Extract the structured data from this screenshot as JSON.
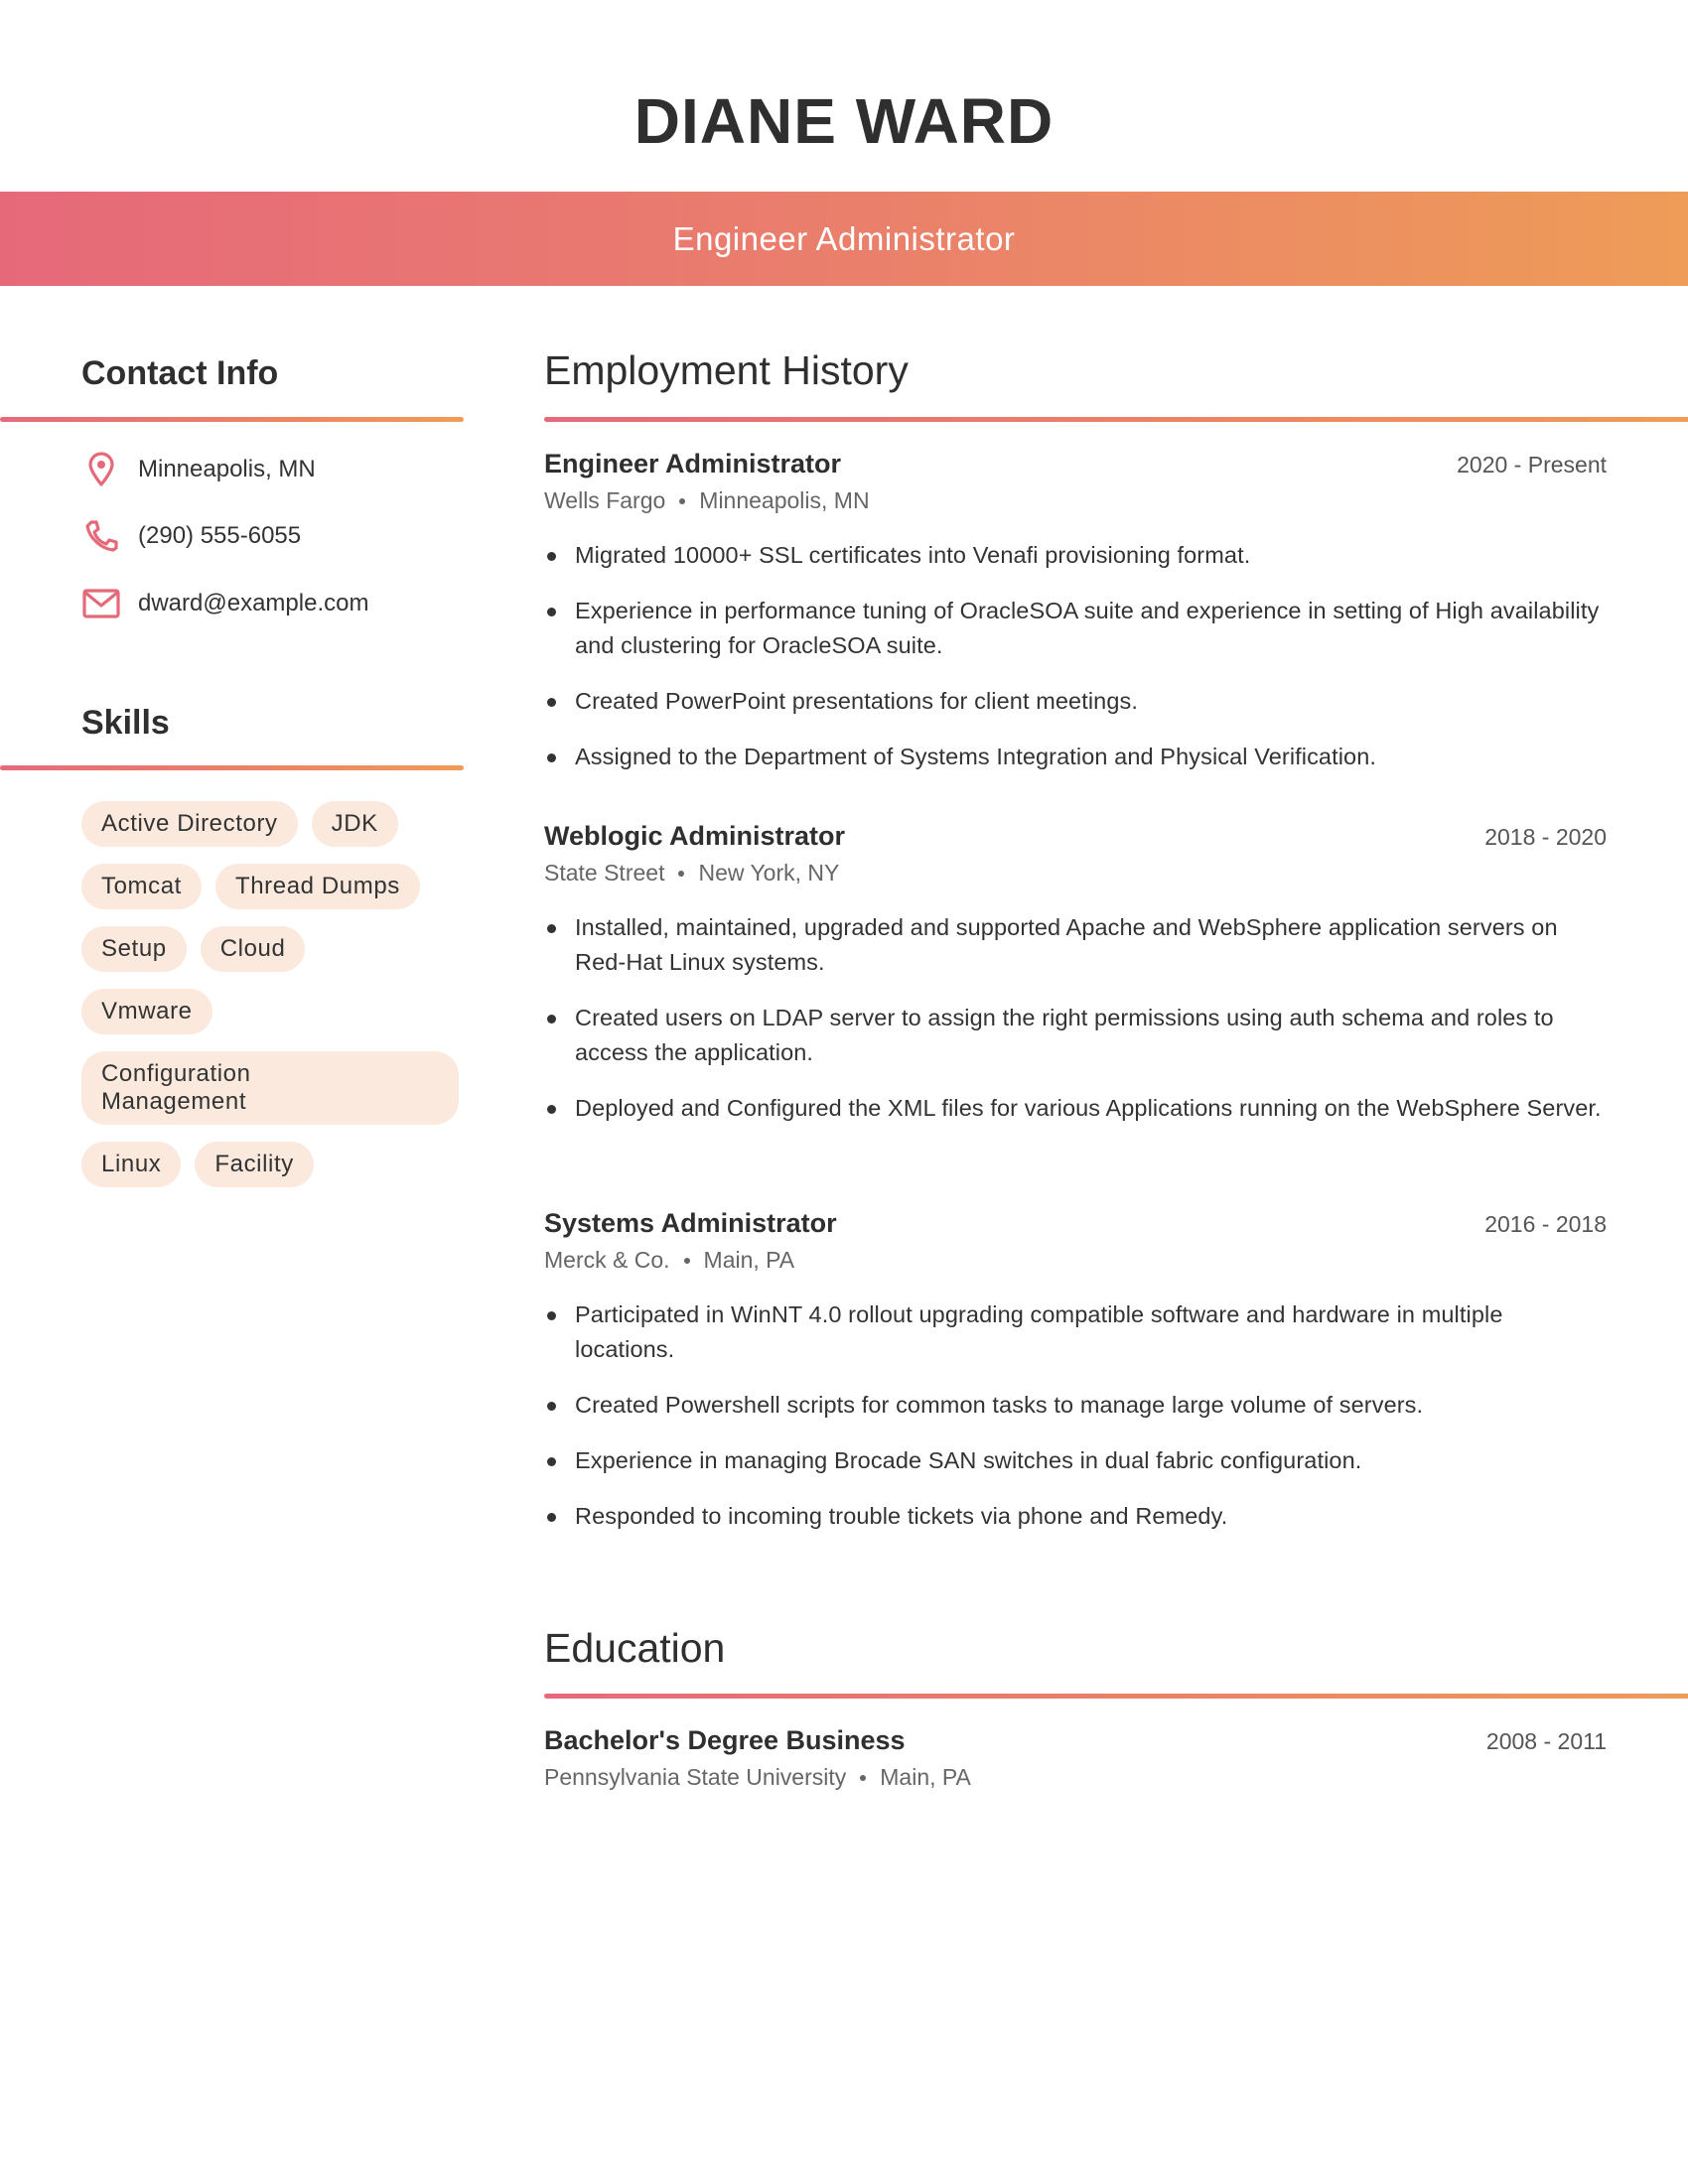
{
  "header": {
    "name": "DIANE WARD",
    "title": "Engineer Administrator"
  },
  "colors": {
    "gradient_start": "#e6697a",
    "gradient_end": "#ee9c58",
    "pill_bg": "#fbe9dd",
    "icon": "#e46a7a",
    "text": "#333333"
  },
  "contact": {
    "heading": "Contact Info",
    "items": [
      {
        "icon": "location-pin-icon",
        "text": "Minneapolis, MN"
      },
      {
        "icon": "phone-icon",
        "text": "(290) 555-6055"
      },
      {
        "icon": "mail-icon",
        "text": "dward@example.com"
      }
    ]
  },
  "skills": {
    "heading": "Skills",
    "items": [
      "Active Directory",
      "JDK",
      "Tomcat",
      "Thread Dumps",
      "Setup",
      "Cloud",
      "Vmware",
      "Configuration Management",
      "Linux",
      "Facility"
    ]
  },
  "employment": {
    "heading": "Employment History",
    "jobs": [
      {
        "title": "Engineer Administrator",
        "dates": "2020 - Present",
        "company": "Wells Fargo",
        "location": "Minneapolis, MN",
        "bullets": [
          "Migrated 10000+ SSL certificates into Venafi provisioning format.",
          "Experience in performance tuning of OracleSOA suite and experience in setting of High availability and clustering for OracleSOA suite.",
          "Created PowerPoint presentations for client meetings.",
          "Assigned to the Department of Systems Integration and Physical Verification."
        ]
      },
      {
        "title": "Weblogic Administrator",
        "dates": "2018 - 2020",
        "company": "State Street",
        "location": "New York, NY",
        "bullets": [
          "Installed, maintained, upgraded and supported Apache and WebSphere application servers on Red-Hat Linux systems.",
          "Created users on LDAP server to assign the right permissions using auth schema and roles to access the application.",
          "Deployed and Configured the XML files for various Applications running on the WebSphere Server."
        ]
      },
      {
        "title": "Systems Administrator",
        "dates": "2016 - 2018",
        "company": "Merck & Co.",
        "location": "Main, PA",
        "bullets": [
          "Participated in WinNT 4.0 rollout upgrading compatible software and hardware in multiple locations.",
          "Created Powershell scripts for common tasks to manage large volume of servers.",
          "Experience in managing Brocade SAN switches in dual fabric configuration.",
          "Responded to incoming trouble tickets via phone and Remedy."
        ]
      }
    ]
  },
  "education": {
    "heading": "Education",
    "items": [
      {
        "degree": "Bachelor's Degree Business",
        "dates": "2008 - 2011",
        "school": "Pennsylvania State University",
        "location": "Main, PA"
      }
    ]
  }
}
